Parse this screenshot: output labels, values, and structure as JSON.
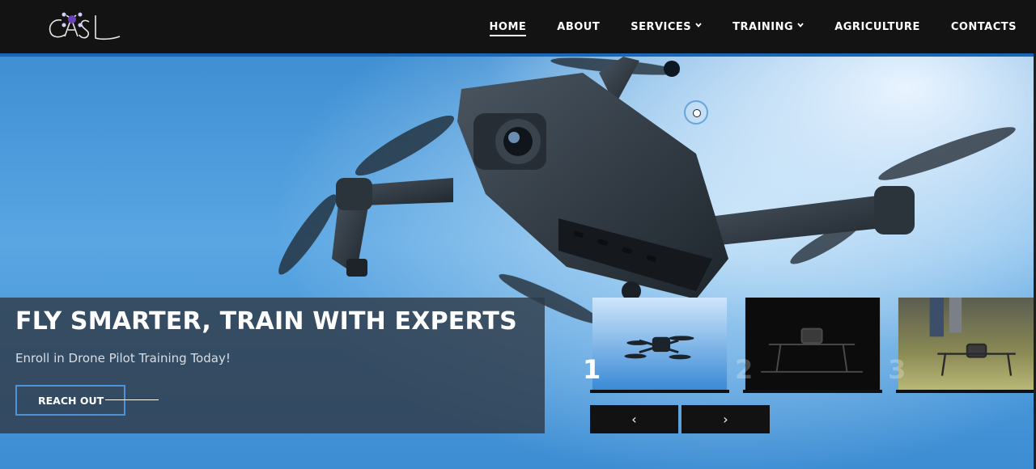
{
  "logo": {
    "text": "CASL",
    "icon": "drone-logo-icon"
  },
  "nav": {
    "items": [
      {
        "label": "HOME",
        "active": true,
        "dropdown": false
      },
      {
        "label": "ABOUT",
        "active": false,
        "dropdown": false
      },
      {
        "label": "SERVICES",
        "active": false,
        "dropdown": true
      },
      {
        "label": "TRAINING",
        "active": false,
        "dropdown": true
      },
      {
        "label": "AGRICULTURE",
        "active": false,
        "dropdown": false
      },
      {
        "label": "CONTACTS",
        "active": false,
        "dropdown": false
      }
    ],
    "dropdown_icon": "chevron-down-icon"
  },
  "hero": {
    "title": "FLY SMARTER, TRAIN WITH EXPERTS",
    "subtitle": "Enroll in Drone Pilot Training Today!",
    "cta_label": "REACH OUT",
    "slides": [
      {
        "number": "1",
        "active": true
      },
      {
        "number": "2",
        "active": false
      },
      {
        "number": "3",
        "active": false
      }
    ],
    "prev_icon": "chevron-left-icon",
    "next_icon": "chevron-right-icon",
    "prev_symbol": "‹",
    "next_symbol": "›"
  },
  "colors": {
    "navbar": "#131313",
    "accent": "#1a66b7",
    "sky": "#5aa6e3",
    "button_border": "#4e93d8"
  }
}
